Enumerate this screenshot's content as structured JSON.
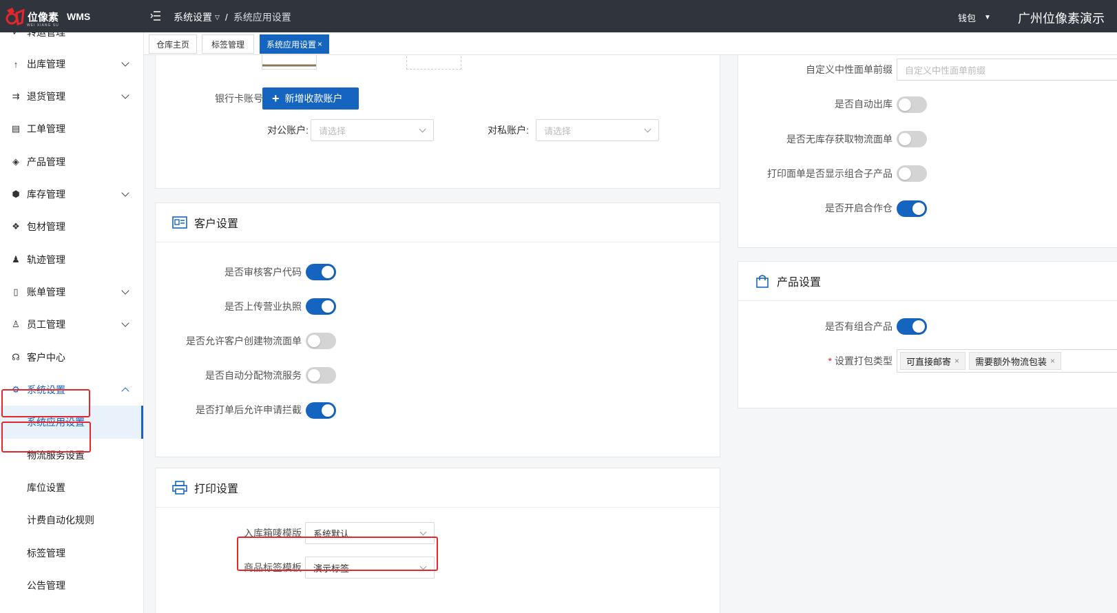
{
  "header": {
    "logo_text": "位像素",
    "logo_sub": "WEI XIANG SU",
    "logo_wms": "WMS",
    "crumb_root": "系统设置",
    "crumb_sep": "/",
    "crumb_current": "系统应用设置",
    "wallet": "钱包",
    "company": "广州位像素演示"
  },
  "sidebar": {
    "items": [
      {
        "label": "转运管理",
        "icon": "check-icon"
      },
      {
        "label": "出库管理",
        "icon": "arrow-up-icon"
      },
      {
        "label": "退货管理",
        "icon": "return-icon"
      },
      {
        "label": "工单管理",
        "icon": "document-icon"
      },
      {
        "label": "产品管理",
        "icon": "cube-outline-icon"
      },
      {
        "label": "库存管理",
        "icon": "box-icon"
      },
      {
        "label": "包材管理",
        "icon": "boxes-icon"
      },
      {
        "label": "轨迹管理",
        "icon": "bell-icon"
      },
      {
        "label": "账单管理",
        "icon": "bill-icon"
      },
      {
        "label": "员工管理",
        "icon": "user-icon"
      },
      {
        "label": "客户中心",
        "icon": "customer-icon"
      },
      {
        "label": "系统设置",
        "icon": "gear-icon"
      }
    ],
    "sub_items": [
      "系统应用设置",
      "物流服务设置",
      "库位设置",
      "计费自动化规则",
      "标签管理",
      "公告管理"
    ]
  },
  "tabs": {
    "home": "仓库主页",
    "labels": "标签管理",
    "current": "系统应用设置",
    "close": "×"
  },
  "bank": {
    "label": "银行卡账号",
    "add_button": "新增收款账户",
    "public_label": "对公账户:",
    "public_placeholder": "请选择",
    "private_label": "对私账户:",
    "private_placeholder": "请选择"
  },
  "customer": {
    "title": "客户设置",
    "toggles": [
      {
        "label": "是否审核客户代码",
        "on": true
      },
      {
        "label": "是否上传营业执照",
        "on": true
      },
      {
        "label": "是否允许客户创建物流面单",
        "on": false
      },
      {
        "label": "是否自动分配物流服务",
        "on": false
      },
      {
        "label": "是否打单后允许申请拦截",
        "on": true
      }
    ]
  },
  "print": {
    "title": "打印设置",
    "inbound_label": "入库箱唛模版",
    "inbound_value": "系统默认",
    "product_label": "商品标签模板",
    "product_value": "演示标签"
  },
  "right_top": {
    "suffix_label": "自定义中性面单前缀",
    "suffix_placeholder": "自定义中性面单前缀",
    "toggles": [
      {
        "label": "是否自动出库",
        "on": false
      },
      {
        "label": "是否无库存获取物流面单",
        "on": false
      },
      {
        "label": "打印面单是否显示组合子产品",
        "on": false
      },
      {
        "label": "是否开启合作仓",
        "on": true
      }
    ]
  },
  "product": {
    "title": "产品设置",
    "combo_label": "是否有组合产品",
    "combo_on": true,
    "pack_required": "*",
    "pack_label": "设置打包类型",
    "pack_tags": [
      "可直接邮寄",
      "需要额外物流包装"
    ]
  },
  "colors": {
    "header_bg": "#30343d",
    "primary": "#1565c0",
    "highlight_red": "#e4272c"
  }
}
